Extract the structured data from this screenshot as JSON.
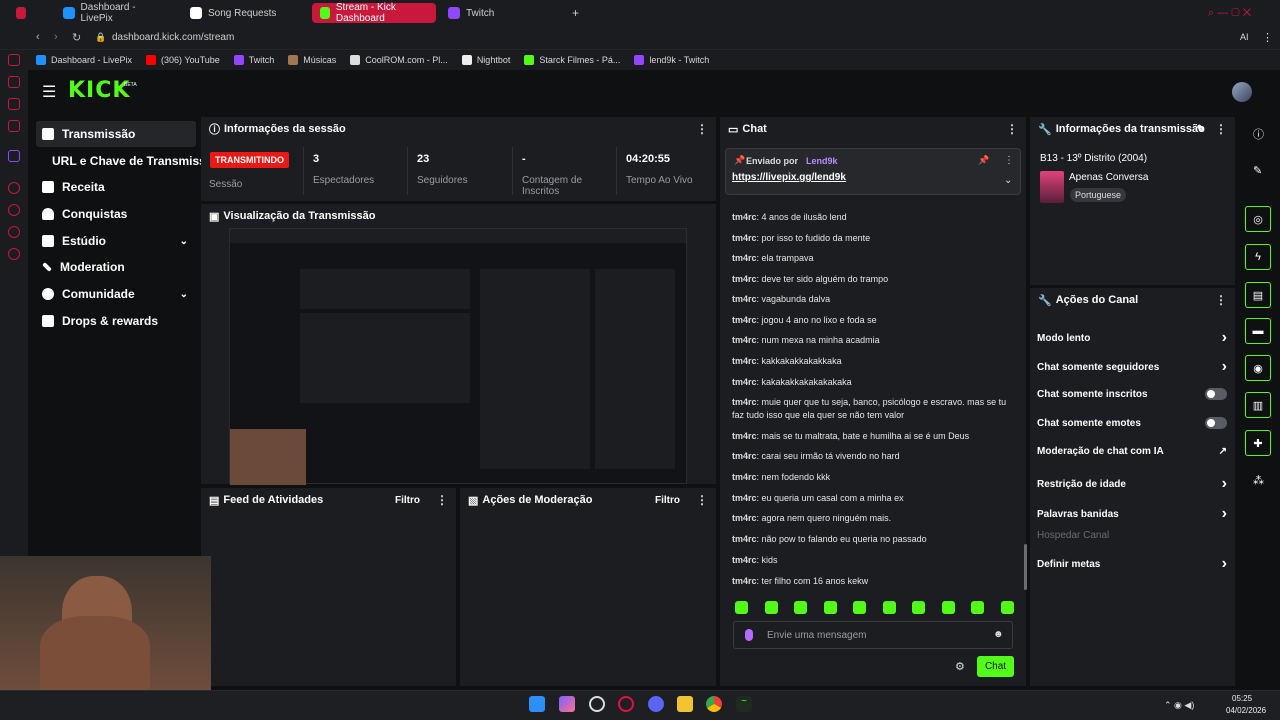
{
  "browser": {
    "tabs": [
      {
        "label": "Dashboard - LivePix",
        "color": "#1e90ff"
      },
      {
        "label": "Song Requests",
        "color": "#ffffff"
      },
      {
        "label": "Stream - Kick Dashboard",
        "color": "#53fc18"
      },
      {
        "label": "Twitch",
        "color": "#9146ff"
      }
    ],
    "url": "dashboard.kick.com/stream",
    "bookmarks": [
      "Dashboard - LivePix",
      "(306) YouTube",
      "Twitch",
      "Músicas",
      "CoolROM.com - Pl...",
      "Nightbot",
      "Starck Filmes - Pá...",
      "lend9k - Twitch"
    ],
    "aria": "AI"
  },
  "kick": {
    "logo": "KICK",
    "beta": "BETA",
    "nav": [
      {
        "label": "Transmissão",
        "icon": "broadcast-icon"
      },
      {
        "label": "URL e Chave de Transmissão",
        "icon": ""
      },
      {
        "label": "Receita",
        "icon": "revenue-icon"
      },
      {
        "label": "Conquistas",
        "icon": "trophy-icon"
      },
      {
        "label": "Estúdio",
        "icon": "studio-icon"
      },
      {
        "label": "Moderation",
        "icon": "wrench-icon"
      },
      {
        "label": "Comunidade",
        "icon": "community-icon"
      },
      {
        "label": "Drops & rewards",
        "icon": "drops-icon"
      }
    ]
  },
  "session": {
    "title": "Informações da sessão",
    "live_badge": "TRANSMITINDO",
    "stats": [
      {
        "label": "Sessão",
        "value": ""
      },
      {
        "label": "Espectadores",
        "value": "3"
      },
      {
        "label": "Seguidores",
        "value": "23"
      },
      {
        "label": "Contagem de Inscritos",
        "value": "-"
      },
      {
        "label": "Tempo Ao Vivo",
        "value": "04:20:55"
      }
    ]
  },
  "preview": {
    "title": "Visualização da Transmissão"
  },
  "activity": {
    "title": "Feed de Atividades",
    "filter": "Filtro"
  },
  "moderation": {
    "title": "Ações de Moderação",
    "filter": "Filtro"
  },
  "chat": {
    "title": "Chat",
    "pinned_by_prefix": "Enviado por",
    "pinned_by": "Lend9k",
    "pinned_link": "https://livepix.gg/lend9k",
    "messages": [
      {
        "user": "tm4rc",
        "text": "4 anos de ilusão lend"
      },
      {
        "user": "tm4rc",
        "text": "por isso to fudido da mente"
      },
      {
        "user": "tm4rc",
        "text": "ela trampava"
      },
      {
        "user": "tm4rc",
        "text": "deve ter sido alguém do trampo"
      },
      {
        "user": "tm4rc",
        "text": "vagabunda dalva"
      },
      {
        "user": "tm4rc",
        "text": "jogou 4 ano no lixo e foda se"
      },
      {
        "user": "tm4rc",
        "text": "num mexa na minha acadmia"
      },
      {
        "user": "tm4rc",
        "text": "kakkakakkakakkaka"
      },
      {
        "user": "tm4rc",
        "text": "kakakakkakakakakaka"
      },
      {
        "user": "tm4rc",
        "text": "muie quer que tu seja, banco, psicólogo e escravo. mas se tu faz tudo isso que ela quer se não tem valor"
      },
      {
        "user": "tm4rc",
        "text": "mais se tu maltrata, bate e humilha ai se é um Deus"
      },
      {
        "user": "tm4rc",
        "text": "carai seu irmão tá vivendo no hard"
      },
      {
        "user": "tm4rc",
        "text": "nem fodendo kkk"
      },
      {
        "user": "tm4rc",
        "text": "eu queria um casal com a minha ex"
      },
      {
        "user": "tm4rc",
        "text": "agora nem quero ninguém mais."
      },
      {
        "user": "tm4rc",
        "text": "não pow to falando eu queria no passado"
      },
      {
        "user": "tm4rc",
        "text": "kids"
      },
      {
        "user": "tm4rc",
        "text": "ter filho com 16 anos kekw"
      }
    ],
    "input_placeholder": "Envie uma mensagem",
    "send_label": "Chat"
  },
  "stream_info": {
    "title": "Informações da transmissão",
    "stream_title": "B13 - 13º Distrito (2004)",
    "category": "Apenas Conversa",
    "language": "Portuguese"
  },
  "channel_actions": {
    "title": "Ações do Canal",
    "items": [
      {
        "label": "Modo lento",
        "control": "chevron"
      },
      {
        "label": "Chat somente seguidores",
        "control": "chevron"
      },
      {
        "label": "Chat somente inscritos",
        "control": "toggle",
        "on": false
      },
      {
        "label": "Chat somente emotes",
        "control": "toggle",
        "on": false
      },
      {
        "label": "Moderação de chat com IA",
        "control": "external"
      },
      {
        "label": "Restrição de idade",
        "control": "chevron"
      },
      {
        "label": "Palavras banidas",
        "control": "chevron"
      },
      {
        "label": "Hospedar Canal",
        "control": "none"
      },
      {
        "label": "Definir metas",
        "control": "chevron"
      }
    ]
  },
  "taskbar": {
    "time": "05:25",
    "date": "04/02/2026"
  },
  "colors": {
    "kick_green": "#53fc18",
    "live_red": "#e91916",
    "opera_red": "#c8183c"
  }
}
